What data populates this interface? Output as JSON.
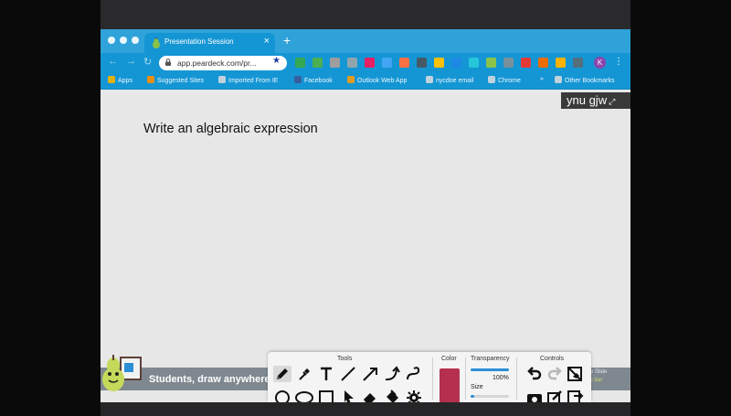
{
  "browser": {
    "tab_title": "Presentation Session",
    "tab_close": "×",
    "new_tab": "+",
    "url": "app.peardeck.com/pr...",
    "profile_initial": "K",
    "bookmarks": [
      {
        "label": "Apps",
        "icon": "apps-grid-icon",
        "color": "#f4b400"
      },
      {
        "label": "Suggested Sites",
        "icon": "suggested-sites-icon",
        "color": "#ff8f00"
      },
      {
        "label": "Imported From IE",
        "icon": "folder-icon",
        "color": "#cfd8dc"
      },
      {
        "label": "Facebook",
        "icon": "facebook-icon",
        "color": "#3b5998"
      },
      {
        "label": "Outlook Web App",
        "icon": "outlook-icon",
        "color": "#f39c12"
      },
      {
        "label": "nycdoe email",
        "icon": "globe-icon",
        "color": "#cfd8dc"
      },
      {
        "label": "Chrome",
        "icon": "globe-icon",
        "color": "#cfd8dc"
      }
    ],
    "bookmarks_overflow": "»",
    "other_bookmarks": "Other Bookmarks",
    "extension_colors": [
      "#34a853",
      "#4caf50",
      "#9e9e9e",
      "#90a4ae",
      "#e91e63",
      "#42a5f5",
      "#ff7043",
      "#455a64",
      "#ffc107",
      "#1e88e5",
      "#26c6da",
      "#8bc34a",
      "#78909c",
      "#e53935",
      "#ef6c00",
      "#ffb300",
      "#546e7a"
    ]
  },
  "content": {
    "prompt": "Write an algebraic expression",
    "name_badge": "ynu gjw",
    "students_text": "Students, draw anywhere o",
    "slide_label": "e Slide",
    "slide_sub": "s bar"
  },
  "draw_panel": {
    "tools_title": "Tools",
    "color_title": "Color",
    "transparency_title": "Transparency",
    "controls_title": "Controls",
    "transparency_value": "100%",
    "transparency_fraction": 1.0,
    "size_label": "Size",
    "size_fraction": 0.1,
    "selected_color": "#b5304c",
    "tools_row1": [
      "pencil-icon",
      "eyedropper-icon",
      "text-icon",
      "line-icon",
      "arrow-icon",
      "curve-arrow-icon",
      "freehand-curve-icon"
    ],
    "tools_row2": [
      "circle-icon",
      "ellipse-icon",
      "rectangle-icon",
      "pointer-icon",
      "eraser-icon",
      "fill-bucket-icon",
      "settings-gear-icon"
    ],
    "controls": [
      "undo-icon",
      "redo-icon",
      "clear-icon",
      "camera-icon",
      "edit-icon",
      "export-icon"
    ]
  }
}
